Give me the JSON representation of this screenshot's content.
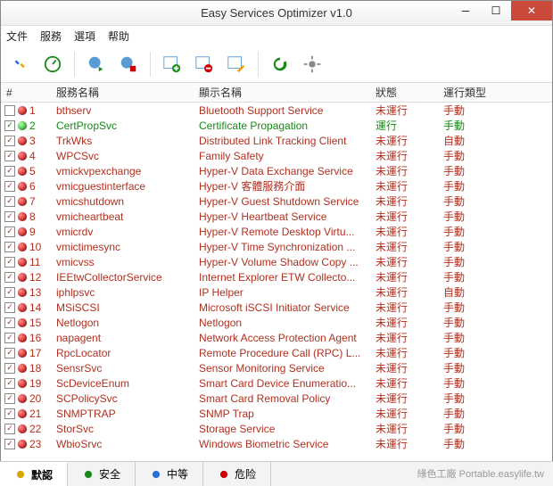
{
  "window": {
    "title": "Easy Services Optimizer v1.0"
  },
  "menu": {
    "file": "文件",
    "service": "服務",
    "options": "選項",
    "help": "帮助"
  },
  "columns": {
    "num": "#",
    "svc": "服務名稱",
    "disp": "顯示名稱",
    "stat": "狀態",
    "type": "運行類型"
  },
  "status": {
    "running": "運行",
    "stopped": "未運行"
  },
  "start": {
    "manual": "手動",
    "auto": "自動"
  },
  "tabs": {
    "default": "默認",
    "safe": "安全",
    "medium": "中等",
    "danger": "危险"
  },
  "footer": "綠色工廠 Portable.easylife.tw",
  "rows": [
    {
      "n": "1",
      "chk": false,
      "run": false,
      "svc": "bthserv",
      "disp": "Bluetooth Support Service",
      "stat": "stopped",
      "type": "manual"
    },
    {
      "n": "2",
      "chk": true,
      "run": true,
      "svc": "CertPropSvc",
      "disp": "Certificate Propagation",
      "stat": "running",
      "type": "manual"
    },
    {
      "n": "3",
      "chk": true,
      "run": false,
      "svc": "TrkWks",
      "disp": "Distributed Link Tracking Client",
      "stat": "stopped",
      "type": "auto"
    },
    {
      "n": "4",
      "chk": true,
      "run": false,
      "svc": "WPCSvc",
      "disp": "Family Safety",
      "stat": "stopped",
      "type": "manual"
    },
    {
      "n": "5",
      "chk": true,
      "run": false,
      "svc": "vmickvpexchange",
      "disp": "Hyper-V Data Exchange Service",
      "stat": "stopped",
      "type": "manual"
    },
    {
      "n": "6",
      "chk": true,
      "run": false,
      "svc": "vmicguestinterface",
      "disp": "Hyper-V 客體服務介面",
      "stat": "stopped",
      "type": "manual"
    },
    {
      "n": "7",
      "chk": true,
      "run": false,
      "svc": "vmicshutdown",
      "disp": "Hyper-V Guest Shutdown Service",
      "stat": "stopped",
      "type": "manual"
    },
    {
      "n": "8",
      "chk": true,
      "run": false,
      "svc": "vmicheartbeat",
      "disp": "Hyper-V Heartbeat Service",
      "stat": "stopped",
      "type": "manual"
    },
    {
      "n": "9",
      "chk": true,
      "run": false,
      "svc": "vmicrdv",
      "disp": "Hyper-V Remote Desktop Virtu...",
      "stat": "stopped",
      "type": "manual"
    },
    {
      "n": "10",
      "chk": true,
      "run": false,
      "svc": "vmictimesync",
      "disp": "Hyper-V Time Synchronization ...",
      "stat": "stopped",
      "type": "manual"
    },
    {
      "n": "11",
      "chk": true,
      "run": false,
      "svc": "vmicvss",
      "disp": "Hyper-V Volume Shadow Copy ...",
      "stat": "stopped",
      "type": "manual"
    },
    {
      "n": "12",
      "chk": true,
      "run": false,
      "svc": "IEEtwCollectorService",
      "disp": "Internet Explorer ETW Collecto...",
      "stat": "stopped",
      "type": "manual"
    },
    {
      "n": "13",
      "chk": true,
      "run": false,
      "svc": "iphlpsvc",
      "disp": "IP Helper",
      "stat": "stopped",
      "type": "auto"
    },
    {
      "n": "14",
      "chk": true,
      "run": false,
      "svc": "MSiSCSI",
      "disp": "Microsoft iSCSI Initiator Service",
      "stat": "stopped",
      "type": "manual"
    },
    {
      "n": "15",
      "chk": true,
      "run": false,
      "svc": "Netlogon",
      "disp": "Netlogon",
      "stat": "stopped",
      "type": "manual"
    },
    {
      "n": "16",
      "chk": true,
      "run": false,
      "svc": "napagent",
      "disp": "Network Access Protection Agent",
      "stat": "stopped",
      "type": "manual"
    },
    {
      "n": "17",
      "chk": true,
      "run": false,
      "svc": "RpcLocator",
      "disp": "Remote Procedure Call (RPC) L...",
      "stat": "stopped",
      "type": "manual"
    },
    {
      "n": "18",
      "chk": true,
      "run": false,
      "svc": "SensrSvc",
      "disp": "Sensor Monitoring Service",
      "stat": "stopped",
      "type": "manual"
    },
    {
      "n": "19",
      "chk": true,
      "run": false,
      "svc": "ScDeviceEnum",
      "disp": "Smart Card Device Enumeratio...",
      "stat": "stopped",
      "type": "manual"
    },
    {
      "n": "20",
      "chk": true,
      "run": false,
      "svc": "SCPolicySvc",
      "disp": "Smart Card Removal Policy",
      "stat": "stopped",
      "type": "manual"
    },
    {
      "n": "21",
      "chk": true,
      "run": false,
      "svc": "SNMPTRAP",
      "disp": "SNMP Trap",
      "stat": "stopped",
      "type": "manual"
    },
    {
      "n": "22",
      "chk": true,
      "run": false,
      "svc": "StorSvc",
      "disp": "Storage Service",
      "stat": "stopped",
      "type": "manual"
    },
    {
      "n": "23",
      "chk": true,
      "run": false,
      "svc": "WbioSrvc",
      "disp": "Windows Biometric Service",
      "stat": "stopped",
      "type": "manual"
    }
  ]
}
